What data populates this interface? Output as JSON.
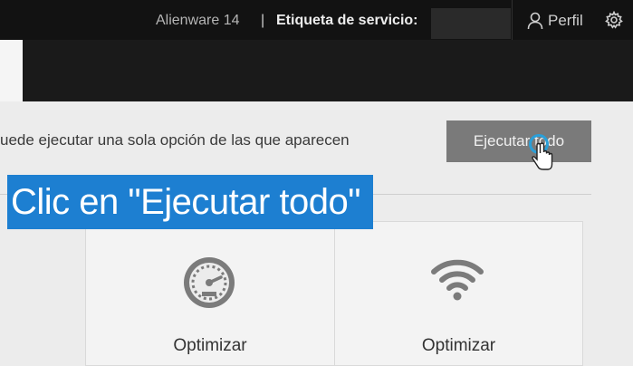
{
  "header": {
    "model": "Alienware 14",
    "separator": "|",
    "service_tag_label": "Etiqueta de servicio:",
    "service_tag_value": "",
    "profile_label": "Perfil",
    "profile_icon": "user-icon",
    "settings_icon": "gear-icon"
  },
  "main": {
    "instruction": "uede ejecutar una sola opción de las que aparecen",
    "run_all_button": "Ejecutar todo",
    "cards": [
      {
        "label": "Optimizar",
        "icon": "speedometer-icon"
      },
      {
        "label": "Optimizar",
        "icon": "wifi-icon"
      }
    ]
  },
  "overlay": {
    "caption": "Clic en \"Ejecutar todo\""
  },
  "colors": {
    "topbar": "#121212",
    "button": "#7a7a7a",
    "caption_bg": "#1d7fd1",
    "cursor_ring": "#2a9fd8"
  }
}
